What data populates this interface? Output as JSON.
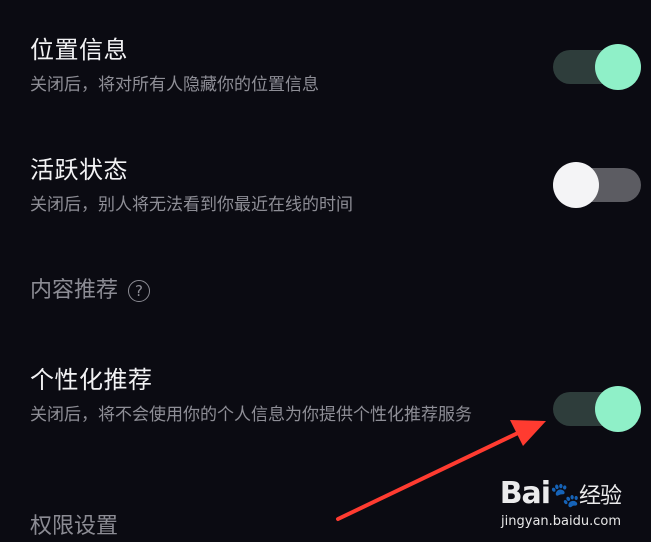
{
  "settings": {
    "location": {
      "title": "位置信息",
      "description": "关闭后，将对所有人隐藏你的位置信息",
      "enabled": true
    },
    "activity": {
      "title": "活跃状态",
      "description": "关闭后，别人将无法看到你最近在线的时间",
      "enabled": false
    },
    "content_section": {
      "title": "内容推荐",
      "help_icon": "question-circle-icon"
    },
    "personalized": {
      "title": "个性化推荐",
      "description": "关闭后，将不会使用你的个人信息为你提供个性化推荐服务",
      "enabled": true
    },
    "permission_section": {
      "title": "权限设置"
    }
  },
  "annotation": {
    "arrow_color": "#ff3b30"
  },
  "watermark": {
    "logo": "Bai",
    "logo_suffix": "经验",
    "url": "jingyan.baidu.com"
  },
  "colors": {
    "background": "#0b0b12",
    "toggle_on_knob": "#8ff0c8",
    "toggle_on_track": "#2e3d3b",
    "toggle_off_knob": "#f4f4f6",
    "toggle_off_track": "#5c5c62"
  }
}
